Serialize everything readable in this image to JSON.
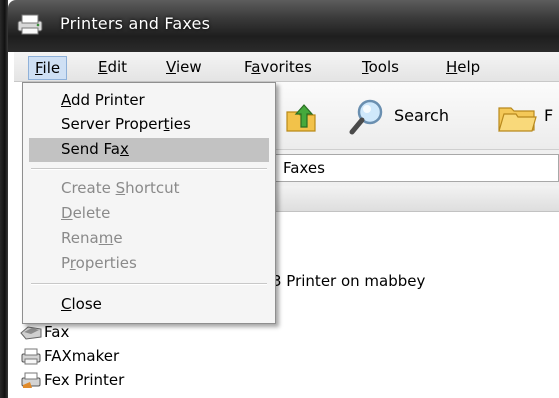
{
  "window": {
    "title": "Printers and Faxes"
  },
  "menubar": {
    "items": [
      {
        "pre": "",
        "mn": "F",
        "post": "ile"
      },
      {
        "pre": "",
        "mn": "E",
        "post": "dit"
      },
      {
        "pre": "",
        "mn": "V",
        "post": "iew"
      },
      {
        "pre": "F",
        "mn": "a",
        "post": "vorites"
      },
      {
        "pre": "",
        "mn": "T",
        "post": "ools"
      },
      {
        "pre": "",
        "mn": "H",
        "post": "elp"
      }
    ]
  },
  "toolbar": {
    "search_label": "Search",
    "folders_label_visible": "F"
  },
  "addressbar": {
    "text_visible": "Faxes"
  },
  "file_menu": {
    "items": [
      {
        "pre": "",
        "mn": "A",
        "post": "dd Printer",
        "state": "normal"
      },
      {
        "pre": "Server Proper",
        "mn": "t",
        "post": "ies",
        "state": "normal"
      },
      {
        "pre": "Send Fa",
        "mn": "x",
        "post": "",
        "state": "highlighted"
      },
      {
        "pre": "Create ",
        "mn": "S",
        "post": "hortcut",
        "state": "disabled"
      },
      {
        "pre": "",
        "mn": "D",
        "post": "elete",
        "state": "disabled"
      },
      {
        "pre": "Rena",
        "mn": "m",
        "post": "e",
        "state": "disabled"
      },
      {
        "pre": "P",
        "mn": "r",
        "post": "operties",
        "state": "disabled"
      },
      {
        "pre": "",
        "mn": "C",
        "post": "lose",
        "state": "normal"
      }
    ]
  },
  "list": {
    "printer_description_visible": "3 Printer on mabbey",
    "rows": [
      {
        "label": "Fax",
        "icon": "fax-icon"
      },
      {
        "label": "FAXmaker",
        "icon": "printer-icon"
      },
      {
        "label": "Fex Printer",
        "icon": "printer-icon"
      }
    ]
  },
  "colors": {
    "menu_highlight": "#c2c2c2",
    "disabled_text": "#8a8a8a",
    "titlebar": "#2b2b2b"
  }
}
